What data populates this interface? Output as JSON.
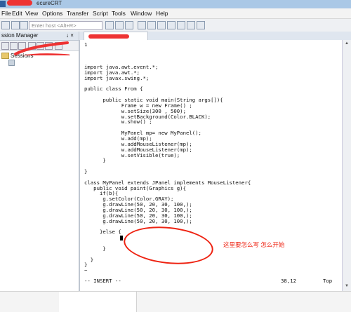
{
  "window": {
    "title": "ecureCRT"
  },
  "menu": [
    "File",
    "Edit",
    "View",
    "Options",
    "Transfer",
    "Script",
    "Tools",
    "Window",
    "Help"
  ],
  "toolbar": {
    "host_placeholder": "Enter host <Alt+R>"
  },
  "session_manager": {
    "title": "ssion Manager",
    "pin": "↓ ×",
    "tree": [
      {
        "label": "Sessions"
      }
    ]
  },
  "editor": {
    "cursor_line": "1",
    "code": "import java.awt.event.*;\nimport java.awt.*;\nimport javax.swing.*;\n\npublic class From {\n\n      public static void main(String args[]){\n            Frame w = new Frame() ;\n            w.setSize(300 , 500);\n            w.setBackground(Color.BLACK);\n            w.show() ;\n\n            MyPanel mp= new MyPanel();\n            w.add(mp);\n            w.addMouseListener(mp);\n            w.addMouseListener(mp);\n            w.setVisible(true);\n      }\n\n}\n\nclass MyPanel extends JPanel implements MouseListener{\n   public void paint(Graphics g){\n     if(b){\n      g.setColor(Color.GRAY);\n      g.drawLine(50, 20, 30, 100,);\n      g.drawLine(50, 20, 30, 100,);\n      g.drawLine(50, 20, 30, 100,);\n      g.drawLine(50, 20, 30, 100,);\n\n     }else {\n\n\n      }\n\n  }\n}\n~",
    "annotation": "这里要怎么写 怎么开始",
    "status": {
      "mode": "-- INSERT --",
      "position": "38,12",
      "scroll": "Top"
    }
  },
  "colors": {
    "annotation": "#e21111",
    "redaction": "#e33333"
  }
}
